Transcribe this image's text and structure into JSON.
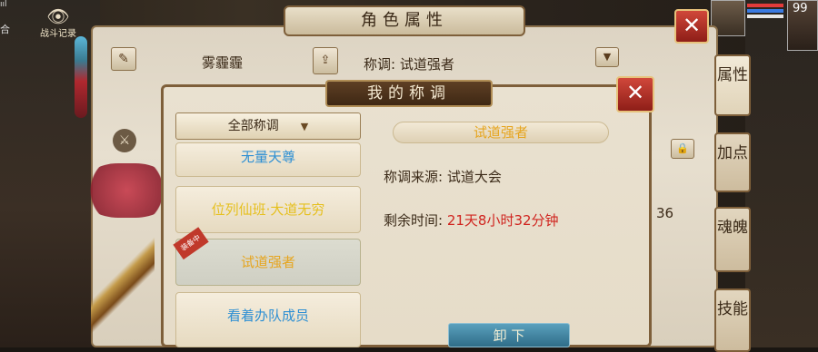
{
  "hud": {
    "signal": "ııl",
    "left_label": "合",
    "battle_record": "战斗记录",
    "level": "99",
    "bar_colors": [
      "#e23b3b",
      "#3b7be2",
      "#e8e8e8"
    ]
  },
  "outer_panel": {
    "title": "角色属性",
    "close_icon": "✕",
    "player_name": "雾霾霾",
    "title_prefix": "称调: 试道强者",
    "side_tabs": [
      "属性",
      "加点",
      "魂魄",
      "技能"
    ],
    "value_36": "36"
  },
  "dialog": {
    "title": "我的称调",
    "close_icon": "✕",
    "filter": {
      "label": "全部称调",
      "arrow": "▼"
    },
    "list": [
      {
        "label": "无量天尊",
        "color": "#2e8fd3"
      },
      {
        "label": "位列仙班·大道无穷",
        "color": "#e6c01f"
      },
      {
        "label": "试道强者",
        "color": "#e6a51f",
        "badge": "装备中"
      },
      {
        "label": "看着办队成员",
        "color": "#2e8fd3"
      }
    ],
    "detail": {
      "name": "试道强者",
      "source_label": "称调来源: 试道大会",
      "time_label": "剩余时间: ",
      "time_value": "21天8小时32分钟"
    },
    "equip_button": "卸 下"
  }
}
